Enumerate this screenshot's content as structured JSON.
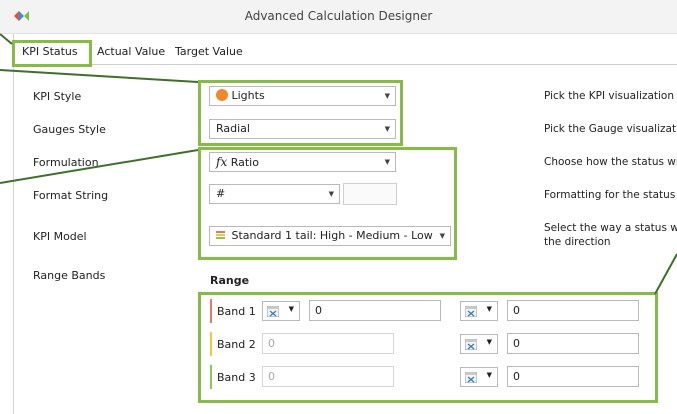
{
  "window": {
    "title": "Advanced Calculation Designer"
  },
  "tabs": [
    "KPI Status",
    "Actual Value",
    "Target Value"
  ],
  "fields": {
    "kpi_style": {
      "label": "KPI Style",
      "value": "Lights",
      "desc": "Pick the KPI visualization"
    },
    "gauges_style": {
      "label": "Gauges Style",
      "value": "Radial",
      "desc": "Pick the Gauge visualizati"
    },
    "formulation": {
      "label": "Formulation",
      "icon_text": "fx",
      "value": "Ratio",
      "desc": "Choose how the status wi"
    },
    "format_string": {
      "label": "Format String",
      "value": "#",
      "desc": "Formatting for the status"
    },
    "kpi_model": {
      "label": "KPI Model",
      "value": "Standard 1 tail: High - Medium - Low",
      "desc_line1": "Select the way a status w",
      "desc_line2": "the direction"
    },
    "range_bands": {
      "label": "Range Bands"
    }
  },
  "range": {
    "header": "Range",
    "bands": [
      {
        "label": "Band 1",
        "color": "#e07b6a",
        "low": "0",
        "high": "0",
        "low_enabled": true
      },
      {
        "label": "Band 2",
        "color": "#f0c93a",
        "low": "0",
        "high": "0",
        "low_enabled": false
      },
      {
        "label": "Band 3",
        "color": "#8cc850",
        "low": "0",
        "high": "0",
        "low_enabled": false
      }
    ]
  },
  "colors": {
    "highlight": "#86bb47",
    "lights_orange": "#f0882d"
  }
}
